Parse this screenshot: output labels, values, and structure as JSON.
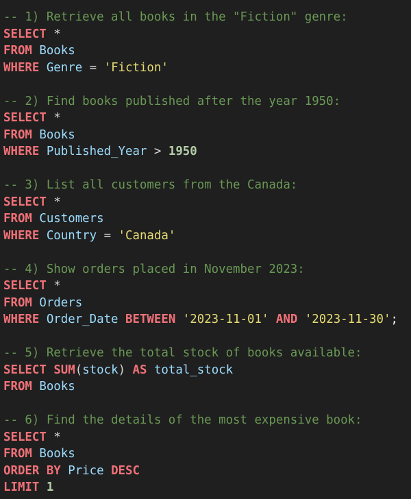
{
  "editor": {
    "lines": [
      [
        {
          "t": "-- 1) Retrieve all books in the \"Fiction\" genre:",
          "c": "comment"
        }
      ],
      [
        {
          "t": "SELECT",
          "c": "kw"
        },
        {
          "t": " *",
          "c": "op"
        }
      ],
      [
        {
          "t": "FROM",
          "c": "kw"
        },
        {
          "t": " Books",
          "c": "id"
        }
      ],
      [
        {
          "t": "WHERE",
          "c": "kw"
        },
        {
          "t": " Genre",
          "c": "id"
        },
        {
          "t": " = ",
          "c": "op"
        },
        {
          "t": "'Fiction'",
          "c": "str"
        }
      ],
      [],
      [
        {
          "t": "-- 2) Find books published after the year 1950:",
          "c": "comment"
        }
      ],
      [
        {
          "t": "SELECT",
          "c": "kw"
        },
        {
          "t": " *",
          "c": "op"
        }
      ],
      [
        {
          "t": "FROM",
          "c": "kw"
        },
        {
          "t": " Books",
          "c": "id"
        }
      ],
      [
        {
          "t": "WHERE",
          "c": "kw"
        },
        {
          "t": " Published_Year",
          "c": "id"
        },
        {
          "t": " > ",
          "c": "op"
        },
        {
          "t": "1950",
          "c": "num"
        }
      ],
      [],
      [
        {
          "t": "-- 3) List all customers from the Canada:",
          "c": "comment"
        }
      ],
      [
        {
          "t": "SELECT",
          "c": "kw"
        },
        {
          "t": " *",
          "c": "op"
        }
      ],
      [
        {
          "t": "FROM",
          "c": "kw"
        },
        {
          "t": " Customers",
          "c": "id"
        }
      ],
      [
        {
          "t": "WHERE",
          "c": "kw"
        },
        {
          "t": " Country",
          "c": "id"
        },
        {
          "t": " = ",
          "c": "op"
        },
        {
          "t": "'Canada'",
          "c": "str"
        }
      ],
      [],
      [
        {
          "t": "-- 4) Show orders placed in November 2023:",
          "c": "comment"
        }
      ],
      [
        {
          "t": "SELECT",
          "c": "kw"
        },
        {
          "t": " *",
          "c": "op"
        }
      ],
      [
        {
          "t": "FROM",
          "c": "kw"
        },
        {
          "t": " Orders",
          "c": "id"
        }
      ],
      [
        {
          "t": "WHERE",
          "c": "kw"
        },
        {
          "t": " Order_Date",
          "c": "id"
        },
        {
          "t": " ",
          "c": "op"
        },
        {
          "t": "BETWEEN",
          "c": "kw"
        },
        {
          "t": " ",
          "c": "op"
        },
        {
          "t": "'2023-11-01'",
          "c": "str"
        },
        {
          "t": " ",
          "c": "op"
        },
        {
          "t": "AND",
          "c": "kw"
        },
        {
          "t": " ",
          "c": "op"
        },
        {
          "t": "'2023-11-30'",
          "c": "str"
        },
        {
          "t": ";",
          "c": "punc"
        }
      ],
      [],
      [
        {
          "t": "-- 5) Retrieve the total stock of books available:",
          "c": "comment"
        }
      ],
      [
        {
          "t": "SELECT",
          "c": "kw"
        },
        {
          "t": " ",
          "c": "op"
        },
        {
          "t": "SUM",
          "c": "kw"
        },
        {
          "t": "(",
          "c": "op"
        },
        {
          "t": "stock",
          "c": "id"
        },
        {
          "t": ") ",
          "c": "op"
        },
        {
          "t": "AS",
          "c": "kw"
        },
        {
          "t": " total_stock",
          "c": "id"
        }
      ],
      [
        {
          "t": "FROM",
          "c": "kw"
        },
        {
          "t": " Books",
          "c": "id"
        }
      ],
      [],
      [
        {
          "t": "-- 6) Find the details of the most expensive book:",
          "c": "comment"
        }
      ],
      [
        {
          "t": "SELECT",
          "c": "kw"
        },
        {
          "t": " *",
          "c": "op"
        }
      ],
      [
        {
          "t": "FROM",
          "c": "kw"
        },
        {
          "t": " Books",
          "c": "id"
        }
      ],
      [
        {
          "t": "ORDER BY",
          "c": "kw"
        },
        {
          "t": " Price",
          "c": "id"
        },
        {
          "t": " ",
          "c": "op"
        },
        {
          "t": "DESC",
          "c": "kw"
        }
      ],
      [
        {
          "t": "LIMIT",
          "c": "kw"
        },
        {
          "t": " ",
          "c": "op"
        },
        {
          "t": "1",
          "c": "num"
        }
      ]
    ]
  },
  "colors": {
    "background": "#1f1f1f",
    "comment": "#6a9955",
    "keyword": "#f07178",
    "identifier": "#9cdcfe",
    "string": "#e6db74",
    "number": "#b5cea8"
  }
}
